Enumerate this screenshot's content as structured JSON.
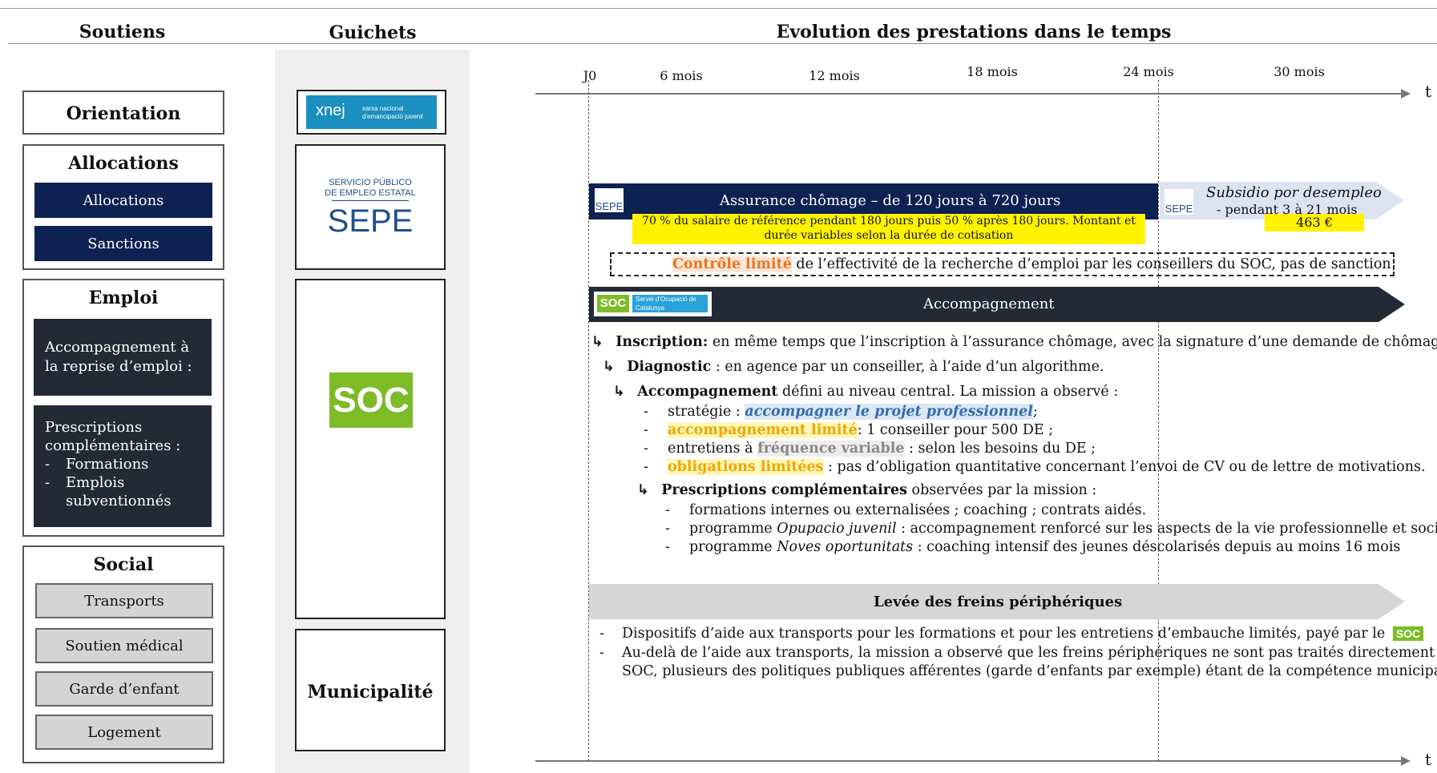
{
  "headers": {
    "soutiens": "Soutiens",
    "guichets": "Guichets",
    "evolution": "Evolution des prestations dans le temps"
  },
  "soutiens": {
    "orientation": "Orientation",
    "allocations": {
      "title": "Allocations",
      "items": [
        "Allocations",
        "Sanctions"
      ]
    },
    "emploi": {
      "title": "Emploi",
      "accompagnement": "Accompagnement à la reprise d’emploi :",
      "prescriptions_title": "Prescriptions complémentaires :",
      "prescriptions_items": [
        "Formations",
        "Emplois subventionnés"
      ]
    },
    "social": {
      "title": "Social",
      "items": [
        "Transports",
        "Soutien médical",
        "Garde d’enfant",
        "Logement"
      ]
    }
  },
  "guichets": {
    "xnej": {
      "mark": "xnej",
      "line1": "xarxa nacional",
      "line2": "d'emancipació juvenil"
    },
    "sepe": {
      "line1": "SERVICIO PÚBLICO",
      "line2": "DE EMPLEO ESTATAL",
      "mark": "SEPE"
    },
    "soc": "SOC",
    "municipalite": "Municipalité"
  },
  "timeline": {
    "ticks": [
      "J0",
      "6 mois",
      "12 mois",
      "18 mois",
      "24 mois",
      "30 mois"
    ],
    "axis_label": "t"
  },
  "assurance": {
    "logo": "SEPE",
    "title": "Assurance chômage – de 120 jours à 720 jours",
    "note": "70 % du salaire de référence pendant 180 jours puis 50 % après 180 jours. Montant et durée variables selon la durée de cotisation",
    "subsidio_logo": "SEPE",
    "subsidio_title": "Subsidio por desempleo",
    "subsidio_sub": "- pendant 3 à 21 mois",
    "subsidio_amount": "463 €"
  },
  "controle": {
    "highlight": "Contrôle limité",
    "rest": " de l’effectivité de la recherche d’emploi par les conseillers du SOC, pas de sanction"
  },
  "accompagnement": {
    "logo": "SOC",
    "logo_sub": "Servei d'Ocupació de Catalunya",
    "title": "Accompagnement",
    "inscription_label": "Inscription:",
    "inscription_text": " en même temps que l’inscription à l’assurance chômage, avec la signature d’une demande de chômage.",
    "diagnostic_label": "Diagnostic",
    "diagnostic_text": " : en agence par un conseiller, à l’aide d’un algorithme.",
    "acc_label": "Accompagnement",
    "acc_text": " défini au niveau central. La mission a observé :",
    "b1_pre": "stratégie : ",
    "b1_hl": "accompagner le projet professionnel",
    "b1_post": ";",
    "b2_hl": "accompagnement limité",
    "b2_post": ":  1 conseiller pour 500 DE ;",
    "b3_pre": "entretiens à ",
    "b3_hl": "fréquence variable",
    "b3_post": " : selon les besoins du DE ;",
    "b4_hl": "obligations limitées",
    "b4_post": " : pas d’obligation quantitative concernant l’envoi de CV ou de lettre de motivations.",
    "presc_label": "Prescriptions complémentaires",
    "presc_text": " observées par la mission :",
    "p1": "formations internes ou externalisées ; coaching ; contrats aidés.",
    "p2_pre": "programme ",
    "p2_it": "Opupacio juvenil",
    "p2_post": " : accompagnement renforcé sur les aspects de la vie professionnelle et sociale.",
    "p3_pre": "programme ",
    "p3_it": "Noves oportunitats",
    "p3_post": " : coaching intensif des jeunes déscolarisés depuis au moins 16 mois"
  },
  "freins": {
    "title": "Levée des freins périphériques",
    "l1": "Dispositifs d’aide aux transports pour les formations et pour les entretiens d’embauche limités, payé par le",
    "l1_logo": "SOC",
    "l2a": "Au-delà de l’aide aux transports, la mission a observé que les freins périphériques ne sont pas traités directement par le",
    "l2b": "SOC, plusieurs des politiques publiques afférentes (garde d’enfants par exemple) étant de la compétence municipale."
  },
  "colors": {
    "navy": "#0d2252",
    "dark": "#222a36",
    "soc_green": "#7dbb27",
    "sepe_blue": "#1f4e8c",
    "yellow": "#fff200",
    "light_blue": "#dce4f2"
  }
}
